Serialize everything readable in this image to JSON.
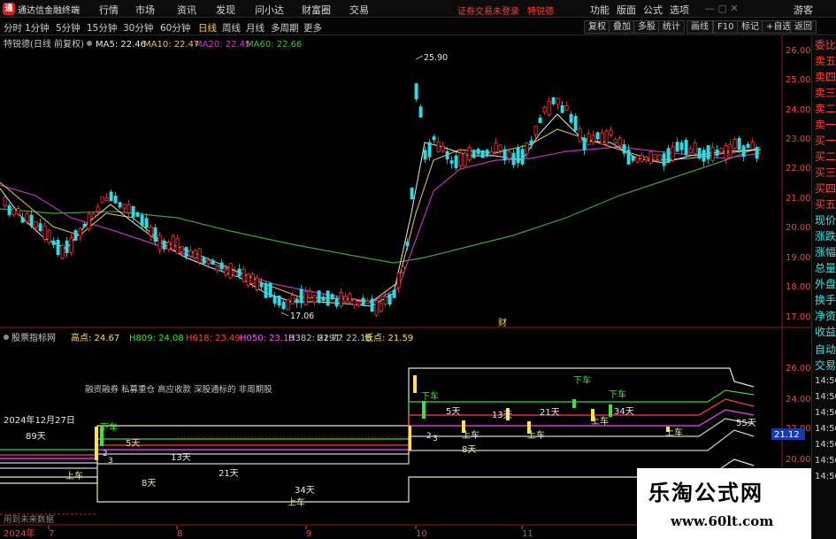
{
  "app": {
    "logo_glyph": "通",
    "title": "通达信金融终端",
    "menus": [
      "行情",
      "市场",
      "资讯",
      "发现",
      "问小达",
      "财富圈",
      "交易"
    ],
    "trade_status": "证券交易未登录",
    "stock_name": "特锐德",
    "right_menus": [
      "功能",
      "版面",
      "公式",
      "选项"
    ],
    "guest": "游客"
  },
  "toolbar": {
    "periods": [
      "分时",
      "1分钟",
      "5分钟",
      "15分钟",
      "30分钟",
      "60分钟",
      "日线",
      "周线",
      "月线",
      "多周期",
      "更多"
    ],
    "active_period": "日线",
    "buttons": [
      "复权",
      "叠加",
      "多股",
      "统计",
      "画线",
      "F10",
      "标记",
      "+自选",
      "返回"
    ]
  },
  "main_chart": {
    "title": "特锐德(日线 前复权)",
    "ma_legend": [
      {
        "label": "MA5: 22.46",
        "color": "#e8e8e8"
      },
      {
        "label": "MA10: 22.47",
        "color": "#e0c860"
      },
      {
        "label": "MA20: 22.45",
        "color": "#d040d0"
      },
      {
        "label": "MA60: 22.66",
        "color": "#40c040"
      }
    ],
    "y_ticks": [
      "26.00",
      "25.00",
      "24.00",
      "23.00",
      "22.00",
      "21.00",
      "20.00",
      "19.00",
      "18.00",
      "17.00"
    ],
    "high_label": "25.90",
    "low_label": "17.06",
    "marker_text": "财"
  },
  "indicator": {
    "title": "股票指标网",
    "legend": [
      {
        "label": "高点: 24.67",
        "color": "#ffe14a"
      },
      {
        "label": "H809: 24.08",
        "color": "#40e040"
      },
      {
        "label": "H618: 23.49",
        "color": "#ff4040"
      },
      {
        "label": "H050: 23.13",
        "color": "#ff50ff"
      },
      {
        "label": "H382: 22.77",
        "color": "#c8c8c8"
      },
      {
        "label": "H191: 22.18",
        "color": "#c8c8c8"
      },
      {
        "label": "低点: 21.59",
        "color": "#ffe14a"
      }
    ],
    "y_ticks": [
      "26.00",
      "24.00",
      "22.00",
      "20.00"
    ],
    "current_price": "21.12",
    "note": "融资融券 私募重仓 高应收款 深股通标的 非周期股",
    "date_label": "2024年12月27日",
    "future_data": "用到未来数据",
    "annotations": [
      "89天",
      "上车",
      "下车",
      "5天",
      "13天",
      "8天",
      "21天",
      "34天",
      "上车",
      "下车",
      "5天",
      "13天",
      "21天",
      "下车",
      "34天",
      "上车",
      "下车",
      "8天",
      "上车",
      "55天",
      "2",
      "3",
      "2",
      "3",
      "上车",
      "上车",
      "上车"
    ]
  },
  "side_panel": {
    "items": [
      "委比",
      "卖五",
      "卖四",
      "卖三",
      "卖二",
      "卖一",
      "买一",
      "买二",
      "买三",
      "买四",
      "买五",
      "现价",
      "涨跌",
      "涨幅",
      "总量",
      "外盘",
      "换手",
      "净资",
      "收益",
      "自动",
      "交易",
      "14:50",
      "14:50",
      "14:50",
      "14:50",
      "14:50",
      "14:50",
      "14:50"
    ]
  },
  "time_axis": {
    "labels": [
      "2024年",
      "7",
      "8",
      "9",
      "10",
      "11"
    ]
  },
  "watermark": {
    "title": "乐淘公式网",
    "url": "www.60lt.com"
  }
}
